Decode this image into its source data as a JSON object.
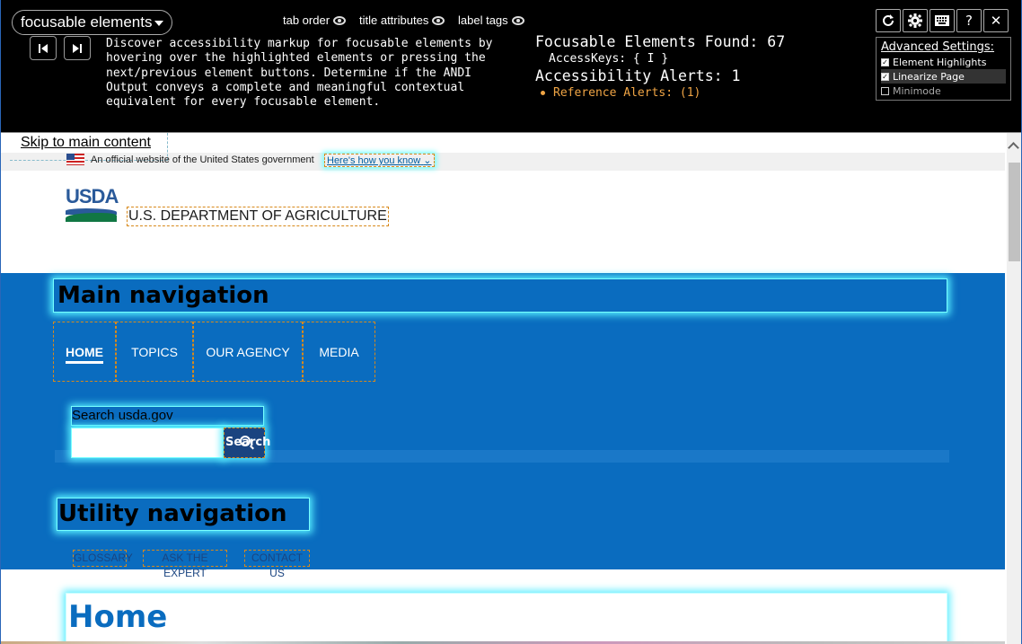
{
  "andi": {
    "module_select": "focusable elements",
    "toggles": {
      "tab_order": "tab order",
      "title_attributes": "title attributes",
      "label_tags": "label tags"
    },
    "instructions": "Discover accessibility markup for focusable elements by hovering over the highlighted elements or pressing the next/previous element buttons. Determine if the ANDI Output conveys a complete and meaningful contextual equivalent for every focusable element.",
    "results": {
      "found": "Focusable Elements Found: 67",
      "accesskeys": "AccessKeys: { I }",
      "alerts": "Accessibility Alerts: 1",
      "reference_alerts": "Reference Alerts: (1)"
    },
    "controls": [
      "refresh-icon",
      "gear-icon",
      "keyboard-icon",
      "help-icon",
      "close-icon"
    ],
    "controls_text": {
      "help": "?",
      "close": "✕"
    },
    "settings": {
      "header": "Advanced Settings:",
      "options": [
        {
          "label": "Element Highlights",
          "checked": true
        },
        {
          "label": "Linearize Page",
          "checked": true
        },
        {
          "label": "Minimode",
          "checked": false
        }
      ]
    }
  },
  "page": {
    "skip_link": "Skip to main content",
    "gov_banner": "An official website of the United States government",
    "hows_link": "Here's how you know",
    "logo_text": "USDA",
    "agency": "U.S. DEPARTMENT OF AGRICULTURE",
    "main_nav_heading": "Main navigation",
    "nav_items": [
      "HOME",
      "TOPICS",
      "OUR AGENCY",
      "MEDIA"
    ],
    "search_label": "Search usda.gov",
    "search_value": "",
    "search_button": "Search",
    "utility_nav_heading": "Utility navigation",
    "utility_items": [
      "GLOSSARY",
      "ASK THE EXPERT",
      "CONTACT US"
    ],
    "home_heading": "Home"
  },
  "colors": {
    "nav_blue": "#0a6cbf",
    "highlight_glow": "#55eeff",
    "focus_dash": "#d8891b",
    "alert_orange": "#f0a545"
  }
}
